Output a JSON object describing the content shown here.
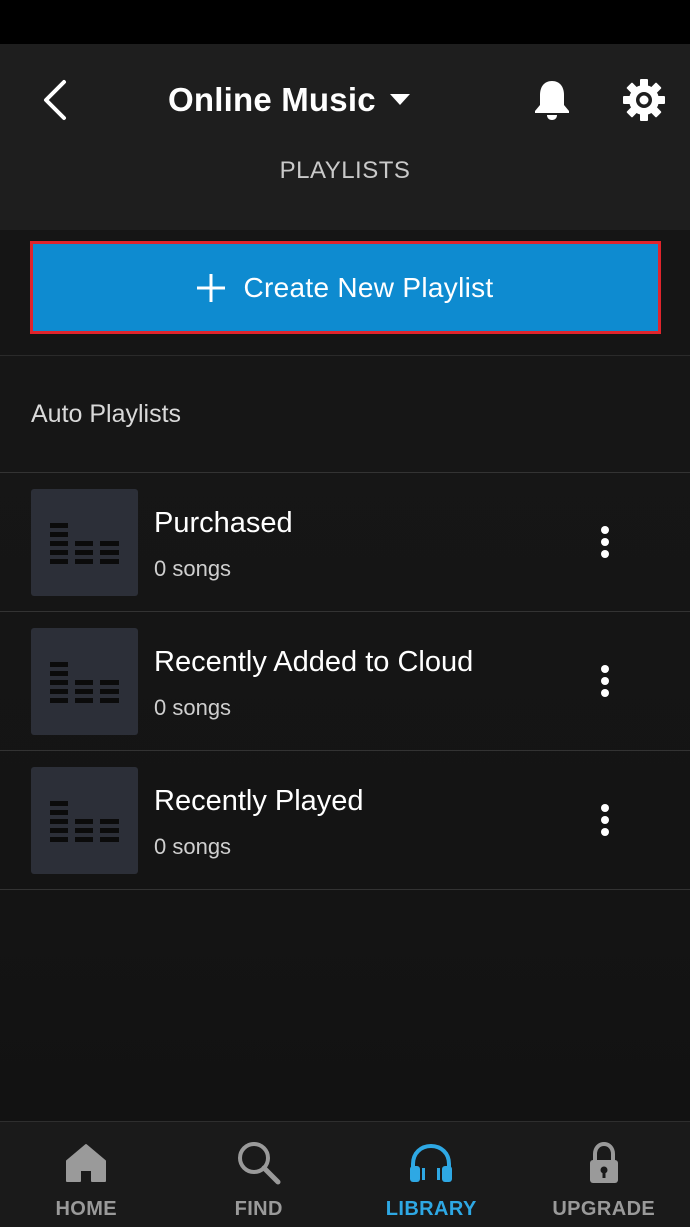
{
  "header": {
    "title": "Online Music",
    "subtitle": "PLAYLISTS"
  },
  "create_button": {
    "label": "Create New Playlist"
  },
  "section": {
    "label": "Auto Playlists"
  },
  "playlists": [
    {
      "title": "Purchased",
      "count": "0 songs"
    },
    {
      "title": "Recently Added to Cloud",
      "count": "0 songs"
    },
    {
      "title": "Recently Played",
      "count": "0 songs"
    }
  ],
  "nav": {
    "items": [
      {
        "label": "HOME",
        "icon": "home-icon",
        "active": false
      },
      {
        "label": "FIND",
        "icon": "search-icon",
        "active": false
      },
      {
        "label": "LIBRARY",
        "icon": "headphones-icon",
        "active": true
      },
      {
        "label": "UPGRADE",
        "icon": "lock-icon",
        "active": false
      }
    ]
  },
  "colors": {
    "accent": "#0e8bd0",
    "active_nav": "#2ea8e4",
    "highlight_border": "#e0242c",
    "background": "#161616"
  }
}
